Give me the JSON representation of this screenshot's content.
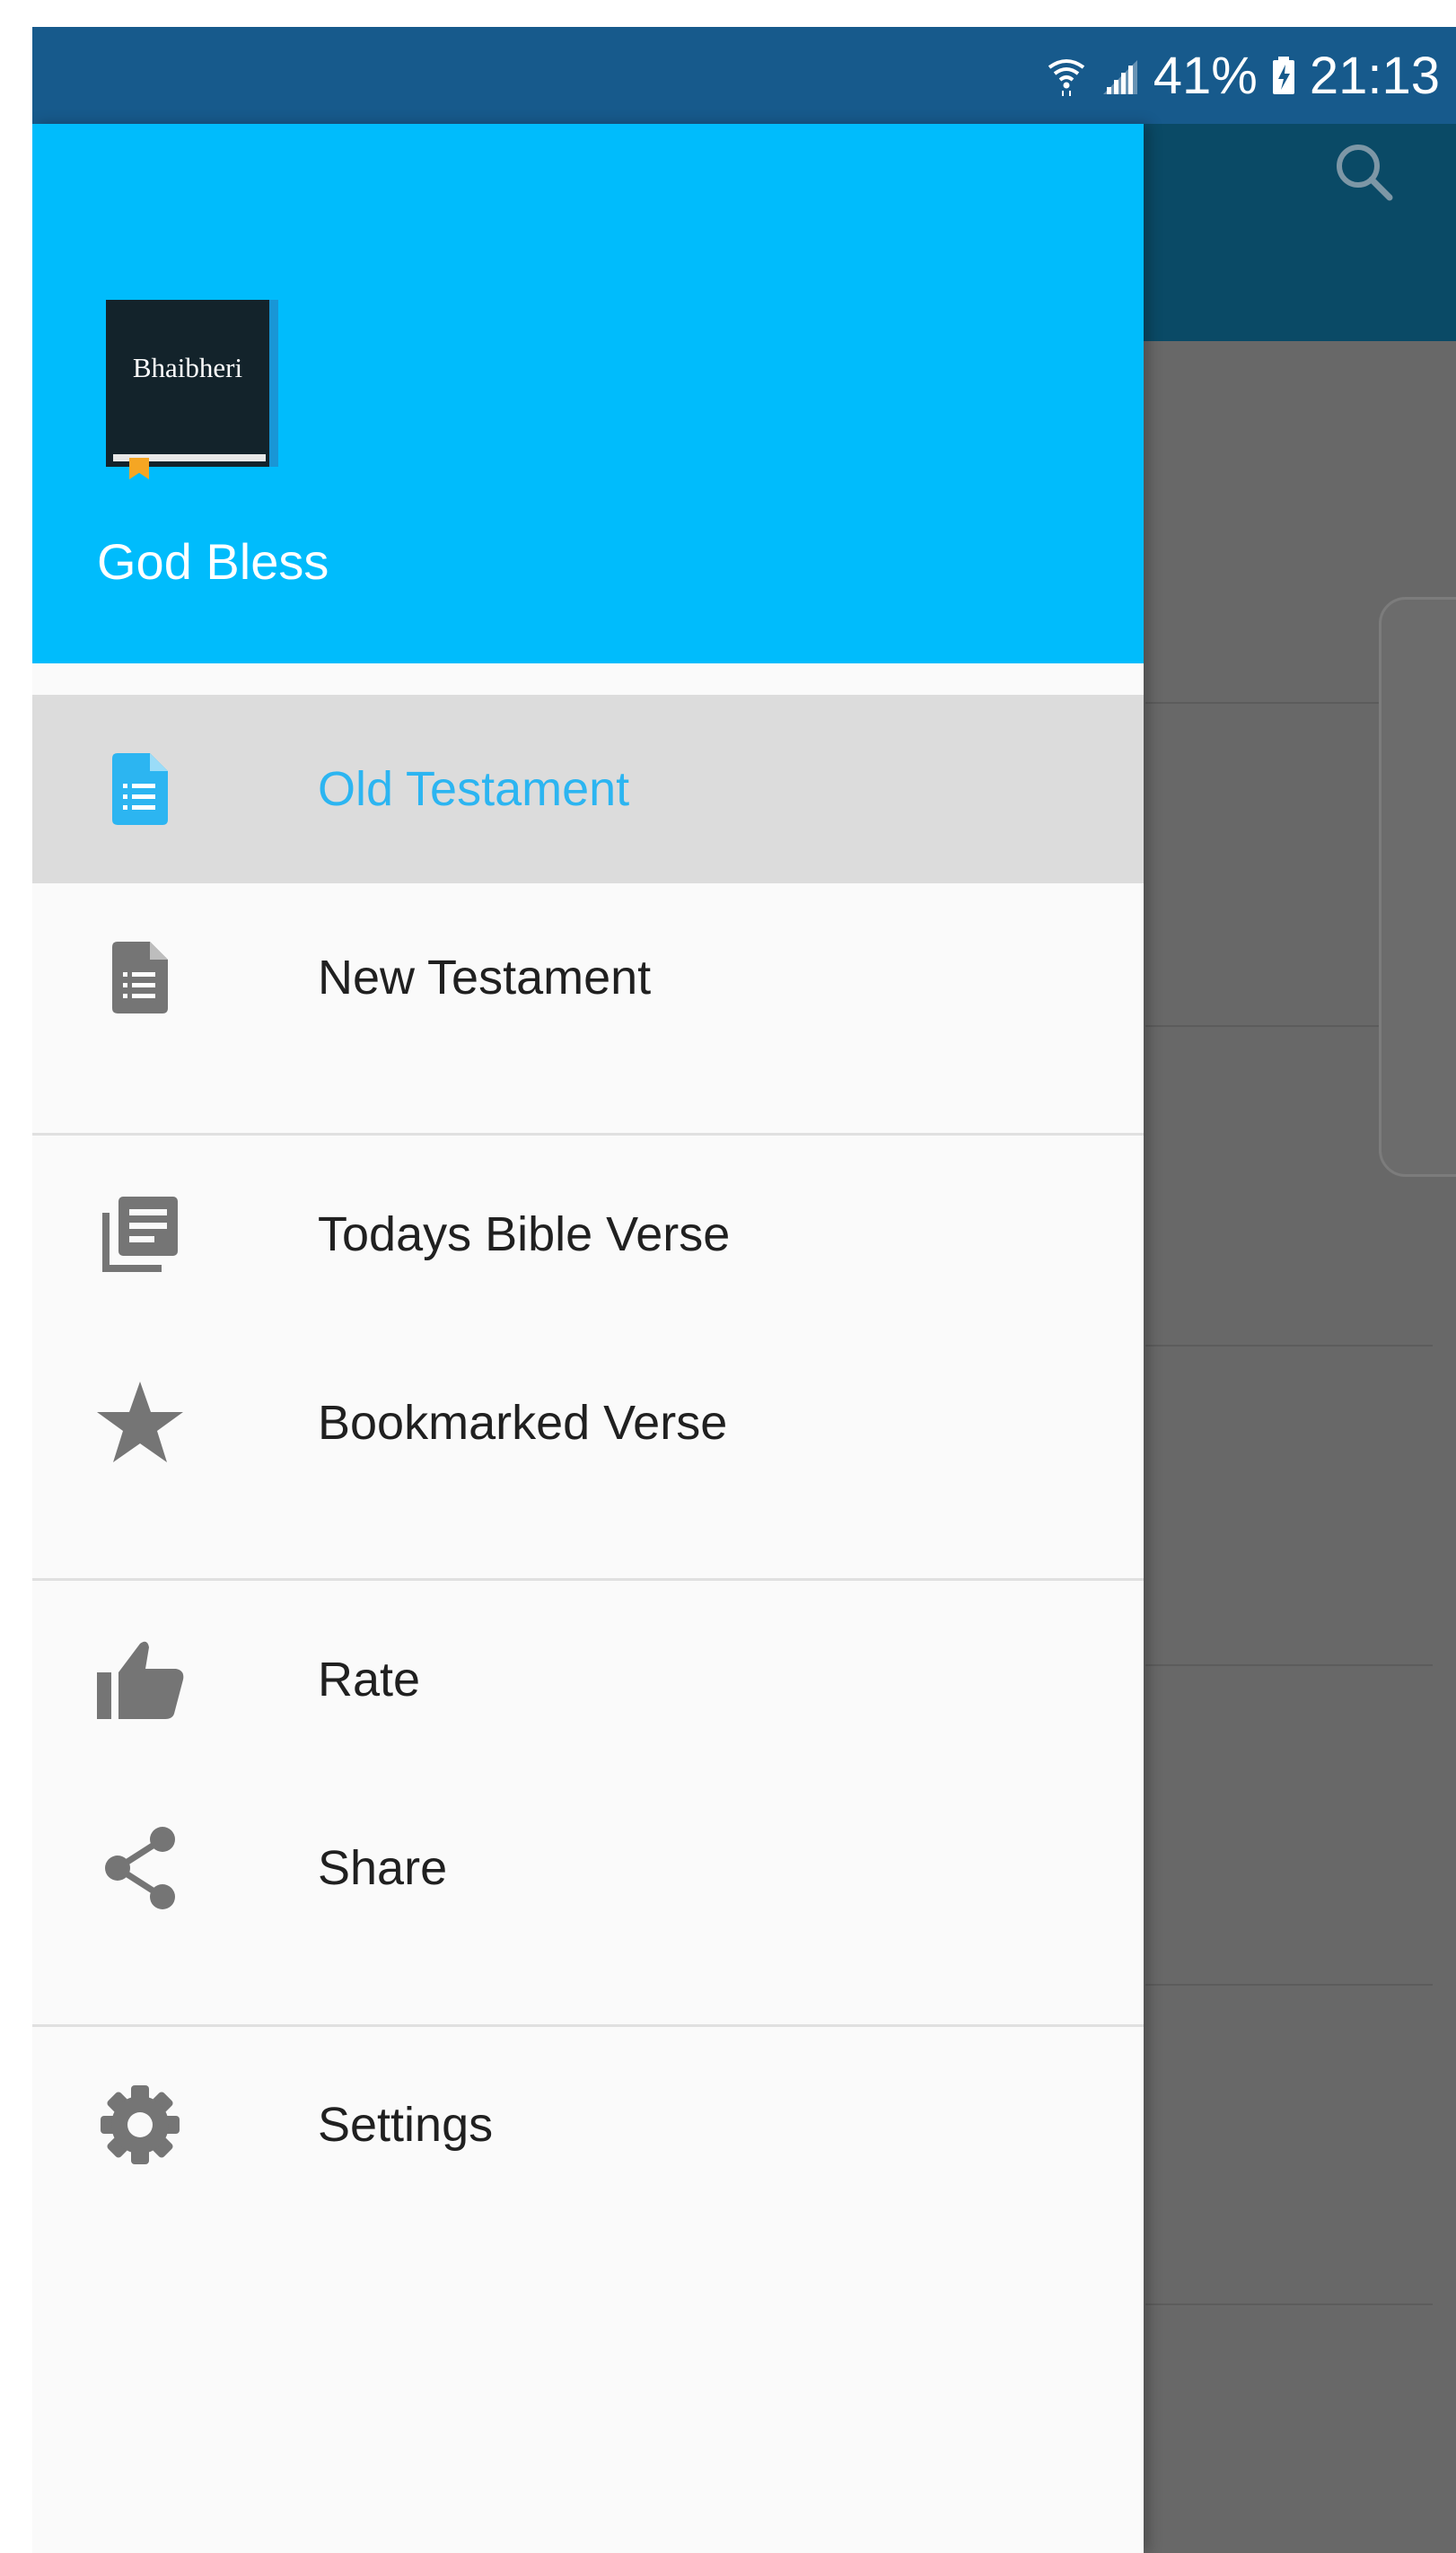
{
  "status_bar": {
    "battery": "41%",
    "time": "21:13",
    "icons": [
      "wifi-icon",
      "signal-icon",
      "battery-charging-icon"
    ]
  },
  "toolbar": {
    "search_icon": "search-icon"
  },
  "drawer": {
    "logo_text": "Bhaibheri",
    "header_title": "God Bless",
    "items": [
      {
        "label": "Old Testament",
        "icon": "document-list-icon",
        "active": true
      },
      {
        "label": "New Testament",
        "icon": "document-list-icon",
        "active": false
      },
      {
        "label": "Todays Bible Verse",
        "icon": "library-books-icon",
        "active": false
      },
      {
        "label": "Bookmarked Verse",
        "icon": "star-icon",
        "active": false
      },
      {
        "label": "Rate",
        "icon": "thumb-up-icon",
        "active": false
      },
      {
        "label": "Share",
        "icon": "share-icon",
        "active": false
      },
      {
        "label": "Settings",
        "icon": "gear-icon",
        "active": false
      }
    ]
  },
  "colors": {
    "status_bar": "#175a8c",
    "drawer_header": "#00bcfc",
    "active_label": "#2cb5f1",
    "active_background": "#dcdcdc",
    "icon_gray": "#757575"
  }
}
